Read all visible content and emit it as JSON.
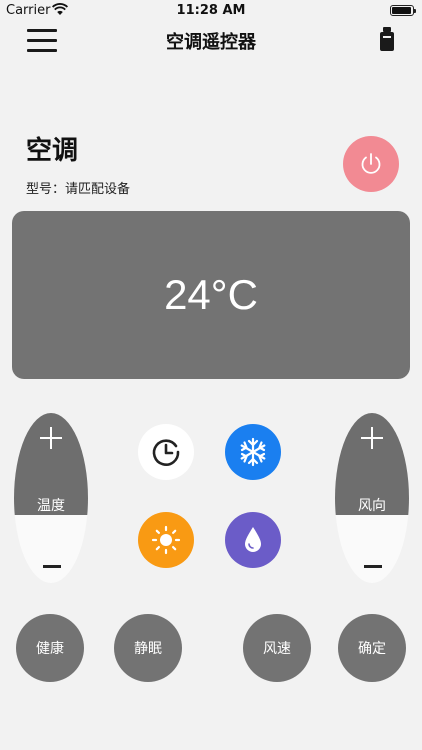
{
  "status_bar": {
    "carrier": "Carrier",
    "time": "11:28 AM"
  },
  "nav": {
    "title": "空调遥控器"
  },
  "device": {
    "name": "空调",
    "model": "型号：请匹配设备"
  },
  "display": {
    "temperature": "24°C"
  },
  "controls": {
    "temperature_label": "温度",
    "wind_direction_label": "风向"
  },
  "modes": [
    {
      "icon": "timer-icon",
      "color": "#ffffff"
    },
    {
      "icon": "snowflake-icon",
      "color": "#1a7ff0"
    },
    {
      "icon": "sun-icon",
      "color": "#f99a13"
    },
    {
      "icon": "water-drop-icon",
      "color": "#6b5cc8"
    }
  ],
  "function_buttons": {
    "health": "健康",
    "sleep": "静眠",
    "fan_speed": "风速",
    "confirm": "确定"
  },
  "colors": {
    "power": "#f28a93",
    "panel": "#737373"
  }
}
